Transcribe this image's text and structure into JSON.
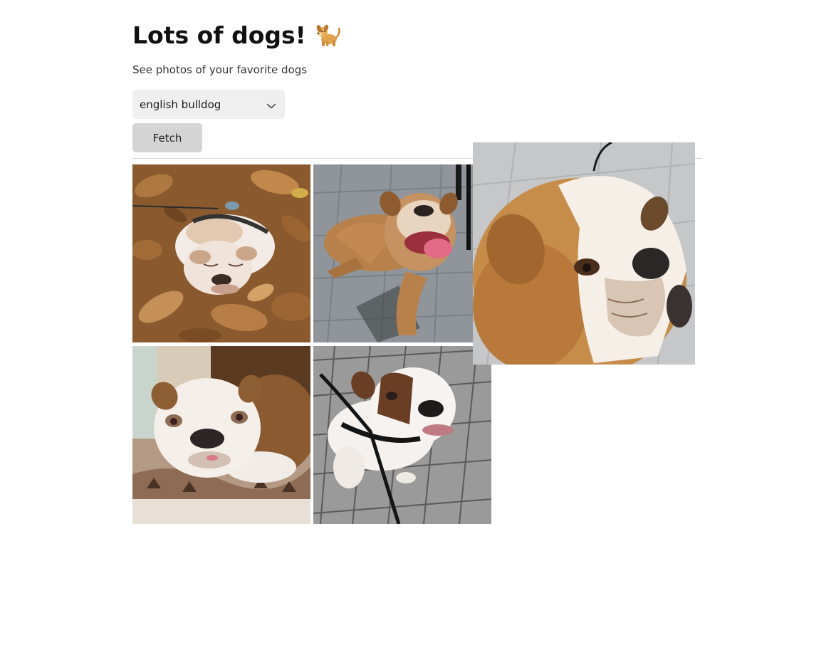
{
  "header": {
    "title": "Lots of dogs!",
    "title_emoji_icon": "dog-emoji-icon",
    "subtitle": "See photos of your favorite dogs"
  },
  "breed_select": {
    "selected": "english bulldog",
    "icon": "chevron-down-icon"
  },
  "fetch_button": {
    "label": "Fetch"
  },
  "gallery": {
    "photos": [
      {
        "subject": "english bulldog lying in autumn leaves"
      },
      {
        "subject": "tan english bulldog lying on stone tiles"
      },
      {
        "subject": "white and brown english bulldog on a cushion"
      },
      {
        "subject": "english bulldog on leash on brick pavement"
      },
      {
        "subject": "close-up of tan and white english bulldog face (enlarged)"
      }
    ]
  },
  "colors": {
    "select_bg": "#efefef",
    "button_bg": "#d4d4d4",
    "divider": "#d6d6d6"
  }
}
